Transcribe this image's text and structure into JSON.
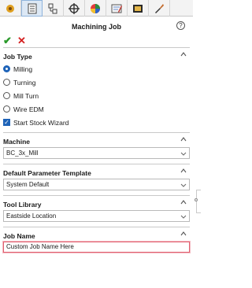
{
  "toolbar": {
    "buttons": [
      {
        "icon": "feature-tree-icon",
        "active": false
      },
      {
        "icon": "property-manager-icon",
        "active": true
      },
      {
        "icon": "configuration-manager-icon",
        "active": false
      },
      {
        "icon": "dimxpert-icon",
        "active": false
      },
      {
        "icon": "display-manager-icon",
        "active": false
      },
      {
        "icon": "cam-feature-tree-icon",
        "active": false
      },
      {
        "icon": "cam-operation-tree-icon",
        "active": false
      },
      {
        "icon": "cam-tool-tree-icon",
        "active": false
      }
    ]
  },
  "header": {
    "title": "Machining Job",
    "help": "?"
  },
  "actions": {
    "ok": "✔",
    "cancel": "✕"
  },
  "job_type": {
    "label": "Job Type",
    "options": [
      {
        "label": "Milling",
        "checked": true
      },
      {
        "label": "Turning",
        "checked": false
      },
      {
        "label": "Mill Turn",
        "checked": false
      },
      {
        "label": "Wire EDM",
        "checked": false
      }
    ],
    "wizard_label": "Start Stock Wizard",
    "wizard_checked": true
  },
  "machine": {
    "label": "Machine",
    "value": "BC_3x_Mill"
  },
  "template": {
    "label": "Default Parameter Template",
    "value": "System Default"
  },
  "tool_library": {
    "label": "Tool Library",
    "value": "Eastside Location"
  },
  "job_name": {
    "label": "Job Name",
    "value": "Custom Job Name Here"
  },
  "colors": {
    "accent": "#1e63b8",
    "ok": "#2b9a2b",
    "cancel": "#d42020",
    "focus": "#e06070"
  }
}
